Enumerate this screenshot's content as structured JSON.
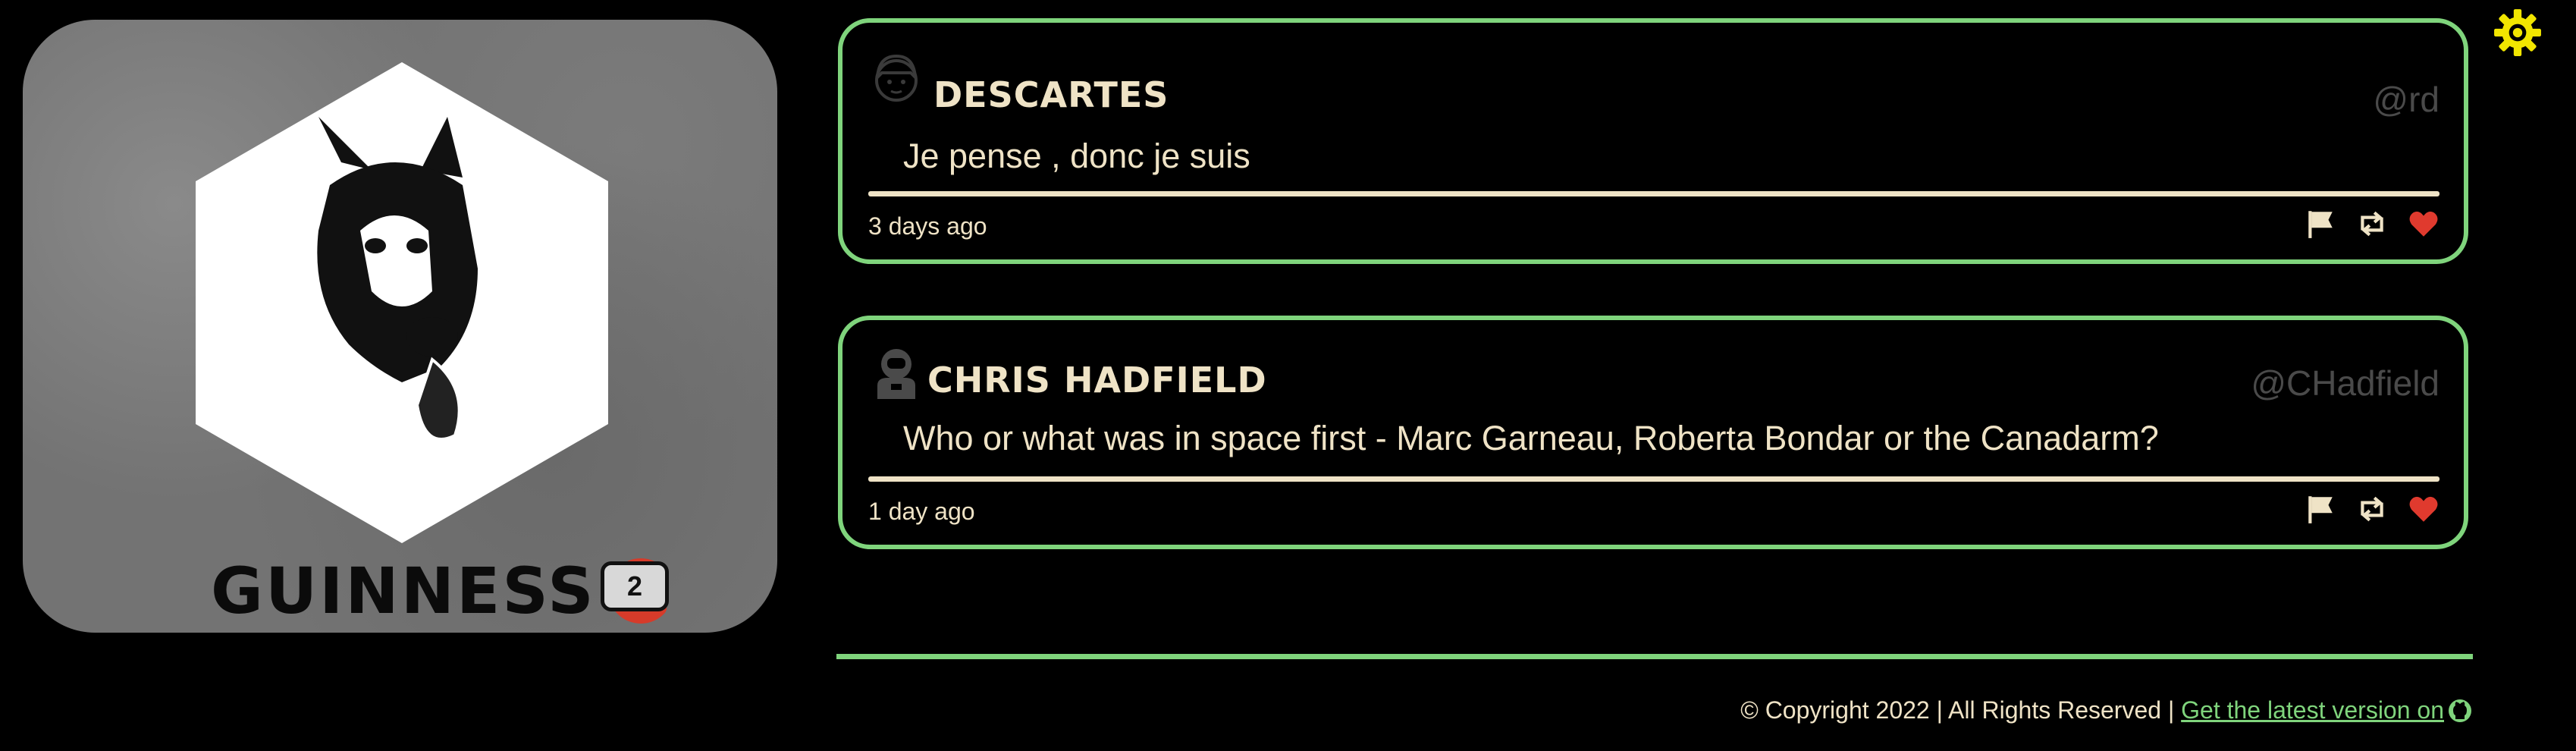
{
  "profile": {
    "display_name": "GUINNESS",
    "badge_count": "2",
    "colors": {
      "verify": "#d63b2a",
      "card_bg": "#737373"
    }
  },
  "settings": {
    "icon": "gear-icon",
    "color": "#f2e600"
  },
  "posts": [
    {
      "author": "DESCARTES",
      "handle": "@rd",
      "text": "Je pense , donc je suis",
      "time": "3 days ago",
      "avatar_icon": "girl-avatar-icon"
    },
    {
      "author": "CHRIS HADFIELD",
      "handle": "@CHadfield",
      "text": "Who or what was in space first - Marc Garneau, Roberta Bondar or the Canadarm?",
      "time": "1 day ago",
      "avatar_icon": "astronaut-avatar-icon"
    }
  ],
  "actions": [
    "flag-icon",
    "retweet-icon",
    "heart-icon"
  ],
  "footer": {
    "copyright": "© Copyright 2022 | All Rights Reserved |",
    "link_text": "Get the latest version on"
  },
  "colors": {
    "accent": "#7fd47c",
    "text": "#efe3c6",
    "heart": "#e03a2e",
    "handle": "#4a4a4a"
  }
}
